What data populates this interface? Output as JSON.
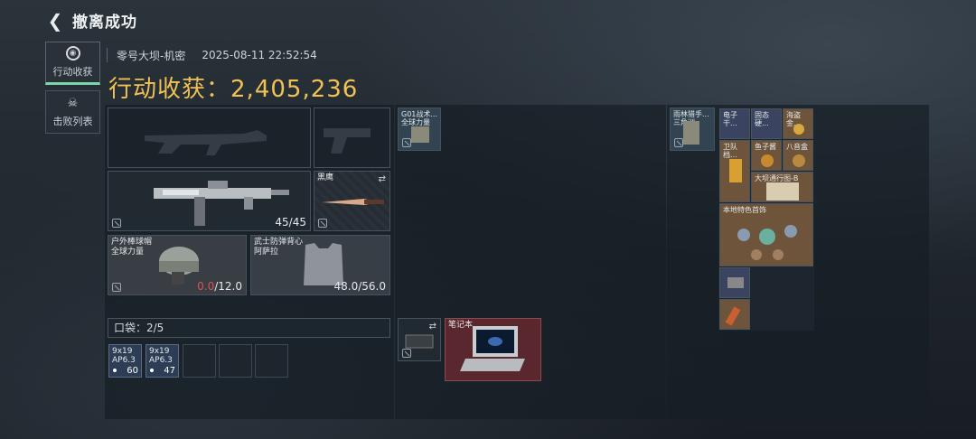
{
  "header": {
    "title": "撤离成功",
    "back_icon": "back-arrow-icon"
  },
  "side_tabs": [
    {
      "label": "行动收获",
      "active": true,
      "icon": "target-icon"
    },
    {
      "label": "击败列表",
      "active": false,
      "icon": "skull-icon"
    }
  ],
  "meta": {
    "map": "零号大坝-机密",
    "datetime": "2025-08-11 22:52:54"
  },
  "loot": {
    "label": "行动收获：",
    "value": "2,405,236"
  },
  "weapon": {
    "ammo": "45/45"
  },
  "knife": {
    "name": "黑鹰"
  },
  "helmet": {
    "name": "户外棒球帽",
    "sub": "全球力量",
    "durability_current": "0.0",
    "durability_max": "/12.0"
  },
  "armor": {
    "name": "武士防弹背心",
    "sub": "阿萨拉",
    "durability": "48.0/56.0"
  },
  "pocket": {
    "label": "口袋：2/5"
  },
  "ammo_items": [
    {
      "name": "9x19",
      "sub": "AP6.3",
      "count": "60"
    },
    {
      "name": "9x19",
      "sub": "AP6.3",
      "count": "47"
    }
  ],
  "chest_rig": {
    "name": "G01战术...",
    "sub": "全球力量"
  },
  "notebook": {
    "name": "笔记本"
  },
  "backpack": {
    "name": "雨林猎手...",
    "sub": "三角洲"
  },
  "items": {
    "r1": [
      "电子干...",
      "固态硬...",
      "海盗金..."
    ],
    "r2": [
      "卫队档...",
      "鱼子酱",
      "八音盒"
    ],
    "map_item": "大坝通行图-B",
    "jewelry": "本地特色首饰"
  },
  "colors": {
    "gold": "#f0c253",
    "accent": "#7ad8a8",
    "red": "#e05050"
  }
}
